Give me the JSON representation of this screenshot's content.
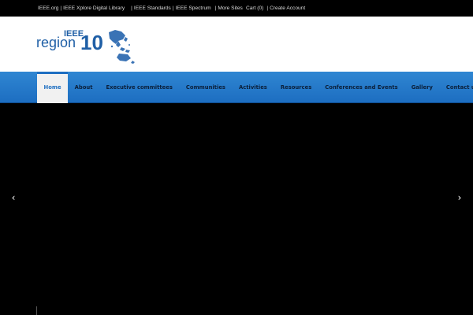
{
  "topbar": {
    "links": [
      "IEEE.org",
      "IEEE Xplore Digital Library",
      "IEEE Standards",
      "IEEE Spectrum",
      "More Sites"
    ],
    "cart": "Cart (0)",
    "account": "Create Account"
  },
  "logo": {
    "ieee": "IEEE",
    "region": "region",
    "number": "10"
  },
  "nav": {
    "items": [
      "Home",
      "About",
      "Executive committees",
      "Communities",
      "Activities",
      "Resources",
      "Conferences and Events",
      "Gallery",
      "Contact us"
    ],
    "active": "Home"
  },
  "slider": {
    "prev_glyph": "‹",
    "next_glyph": "›"
  },
  "colors": {
    "nav_blue": "#1d6ec1",
    "logo_blue": "#1f5fa6",
    "background": "#000000"
  }
}
